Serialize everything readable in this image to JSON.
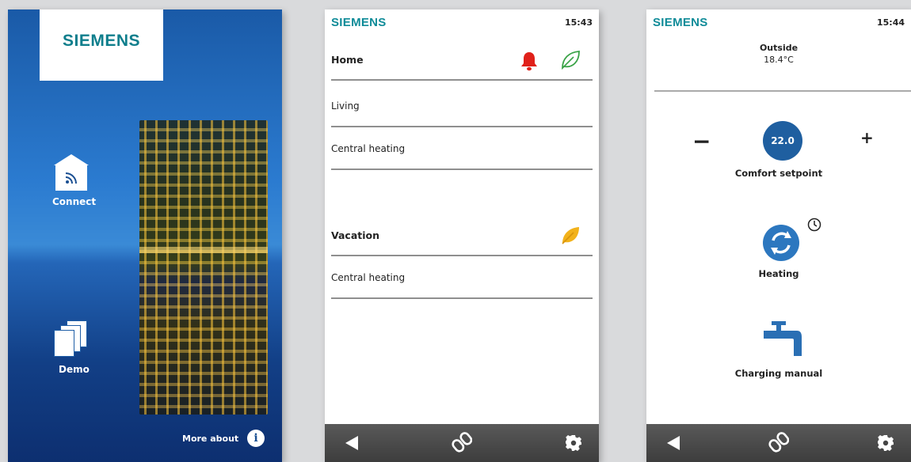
{
  "screen1": {
    "logo": "SIEMENS",
    "connect_label": "Connect",
    "demo_label": "Demo",
    "more_about_label": "More about",
    "info_glyph": "i"
  },
  "screen2": {
    "brand": "SIEMENS",
    "time": "15:43",
    "rows": [
      {
        "label": "Home"
      },
      {
        "label": "Living"
      },
      {
        "label": "Central heating"
      },
      {
        "label": "Vacation"
      },
      {
        "label": "Central heating"
      }
    ],
    "colors": {
      "bell": "#e0211a",
      "leaf_home": "#3aa347",
      "leaf_vacation": "#f2b21b"
    }
  },
  "screen3": {
    "brand": "SIEMENS",
    "time": "15:44",
    "outside_label": "Outside",
    "outside_value": "18.4°C",
    "minus_glyph": "−",
    "plus_glyph": "+",
    "setpoint_value": "22.0",
    "comfort_label": "Comfort setpoint",
    "heating_label": "Heating",
    "charging_label": "Charging manual"
  },
  "nav": {
    "icons": [
      "back-icon",
      "link-icon",
      "gear-icon"
    ]
  },
  "colors": {
    "siemens_teal": "#0f8b98",
    "accent_blue": "#1f5fa0",
    "nav_bar": "#4a4a4a"
  }
}
